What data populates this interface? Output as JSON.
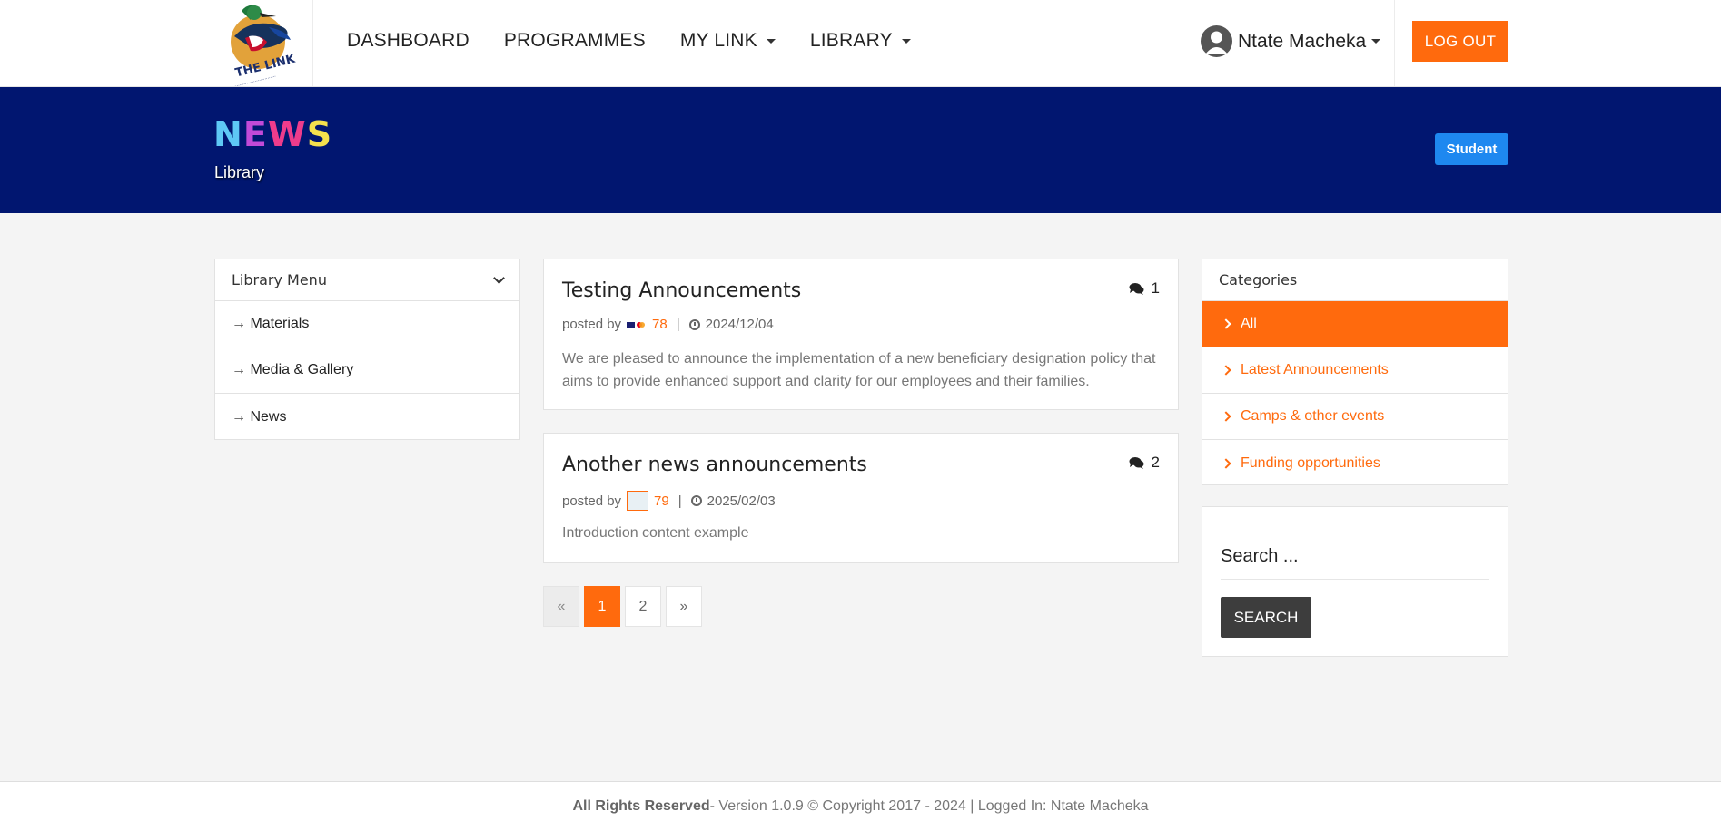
{
  "nav": {
    "logo_text": "THE LINK",
    "items": [
      {
        "label": "DASHBOARD",
        "dropdown": false
      },
      {
        "label": "PROGRAMMES",
        "dropdown": false
      },
      {
        "label": "MY LINK",
        "dropdown": true
      },
      {
        "label": "LIBRARY",
        "dropdown": true
      }
    ],
    "user_name": "Ntate Macheka",
    "logout_label": "LOG OUT"
  },
  "banner": {
    "title_letters": [
      {
        "char": "N",
        "color": "#5ec8f5"
      },
      {
        "char": "E",
        "color": "#c24ad8"
      },
      {
        "char": "W",
        "color": "#ee3c8c"
      },
      {
        "char": "S",
        "color": "#f4e04d"
      }
    ],
    "subtitle": "Library",
    "role_badge": "Student"
  },
  "library_menu": {
    "title": "Library Menu",
    "items": [
      "→ Materials",
      "→ Media & Gallery",
      "→ News"
    ]
  },
  "posts": [
    {
      "title": "Testing Announcements",
      "comments": "1",
      "posted_by_label": "posted by",
      "author": "78",
      "date": "2024/12/04",
      "body": "We are pleased to announce the implementation of a new beneficiary designation policy that aims to provide enhanced support and clarity for our employees and their families."
    },
    {
      "title": "Another news announcements",
      "comments": "2",
      "posted_by_label": "posted by",
      "author": "79",
      "date": "2025/02/03",
      "body": "Introduction content example"
    }
  ],
  "pagination": {
    "prev": "«",
    "pages": [
      "1",
      "2"
    ],
    "active": "1",
    "next": "»"
  },
  "categories": {
    "title": "Categories",
    "items": [
      "All",
      "Latest Announcements",
      "Camps & other events",
      "Funding opportunities"
    ],
    "active": "All"
  },
  "search": {
    "placeholder": "Search ...",
    "button_label": "SEARCH"
  },
  "footer": {
    "rights": "All Rights Reserved",
    "rest": " - Version 1.0.9 © Copyright 2017 - 2024 | Logged In: Ntate Macheka"
  },
  "colors": {
    "accent": "#ff6a0d",
    "banner": "#011670",
    "badge": "#1e88f0"
  }
}
